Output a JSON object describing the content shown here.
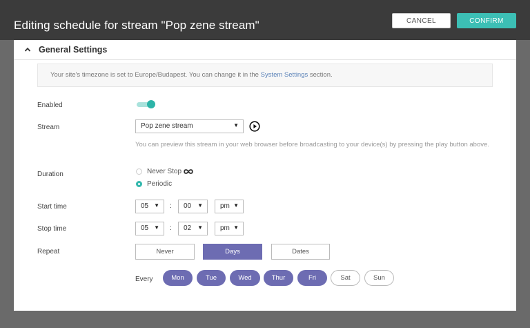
{
  "header": {
    "title": "Editing schedule for stream \"Pop zene stream\"",
    "cancel_label": "CANCEL",
    "confirm_label": "CONFIRM"
  },
  "section": {
    "title": "General Settings",
    "collapse_icon": "chevron-up-icon"
  },
  "notice": {
    "text_before": "Your site's timezone is set to Europe/Budapest. You can change it in the ",
    "link": "System Settings",
    "text_after": " section."
  },
  "enabled": {
    "label": "Enabled",
    "value": true
  },
  "stream": {
    "label": "Stream",
    "selected": "Pop zene stream",
    "play_icon": "play-circle-icon",
    "hint": "You can preview this stream in your web browser before broadcasting to your device(s) by pressing the play button above."
  },
  "duration": {
    "label": "Duration",
    "options": [
      "Never Stop",
      "Periodic"
    ],
    "selected": "Periodic",
    "infinity_icon": "infinity-icon"
  },
  "start_time": {
    "label": "Start time",
    "hour": "05",
    "minute": "00",
    "ampm": "pm"
  },
  "stop_time": {
    "label": "Stop time",
    "hour": "05",
    "minute": "02",
    "ampm": "pm"
  },
  "separator": ":",
  "repeat": {
    "label": "Repeat",
    "options": [
      "Never",
      "Days",
      "Dates"
    ],
    "selected": "Days"
  },
  "every": {
    "label": "Every",
    "days": [
      "Mon",
      "Tue",
      "Wed",
      "Thur",
      "Fri",
      "Sat",
      "Sun"
    ],
    "selected": [
      "Mon",
      "Tue",
      "Wed",
      "Thur",
      "Fri"
    ]
  },
  "colors": {
    "accent": "#3cbfb5",
    "selected": "#6d6cb2",
    "header_bg": "#3b3b3b"
  }
}
